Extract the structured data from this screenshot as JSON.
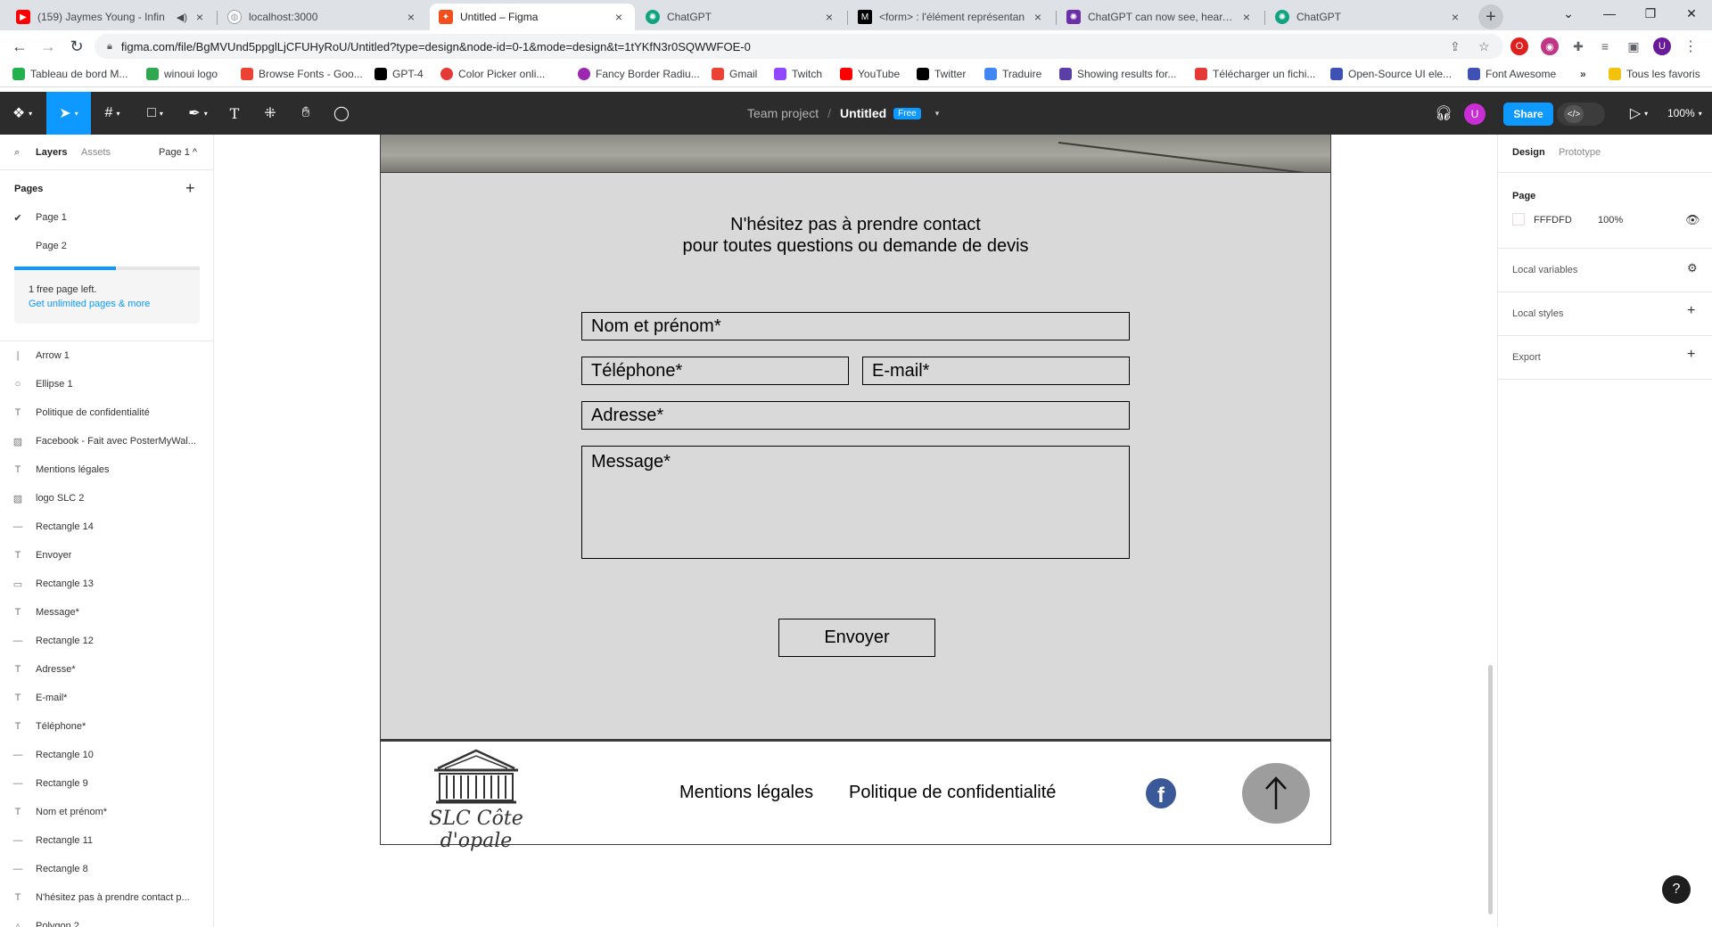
{
  "browser": {
    "tabs": [
      {
        "title": "(159) Jaymes Young - Infin",
        "icon": "youtube-icon",
        "color": "#ff0000"
      },
      {
        "title": "localhost:3000",
        "icon": "globe-icon",
        "color": "#9aa0a6"
      },
      {
        "title": "Untitled – Figma",
        "icon": "figma-icon",
        "color": "#f24e1e",
        "active": true
      },
      {
        "title": "ChatGPT",
        "icon": "chatgpt-icon",
        "color": "#10a37f"
      },
      {
        "title": "<form> : l'élément représentan",
        "icon": "mdn-icon",
        "color": "#000000"
      },
      {
        "title": "ChatGPT can now see, hear, an",
        "icon": "openai-icon",
        "color": "#6b2fa6"
      },
      {
        "title": "ChatGPT",
        "icon": "chatgpt-icon",
        "color": "#10a37f"
      }
    ],
    "url": "figma.com/file/BgMVUnd5ppglLjCFUHyRoU/Untitled?type=design&node-id=0-1&mode=design&t=1tYKfN3r0SQWWFOE-0",
    "bookmarks": [
      {
        "label": "Tableau de bord M...",
        "color": "#22b14c"
      },
      {
        "label": "winoui logo",
        "color": "#2fa84f"
      },
      {
        "label": "Browse Fonts - Goo...",
        "color": "#ea4335"
      },
      {
        "label": "GPT-4",
        "color": "#000000"
      },
      {
        "label": "Color Picker onli...",
        "color": "#e53935"
      },
      {
        "label": "Fancy Border Radiu...",
        "color": "#9c27b0"
      },
      {
        "label": "Gmail",
        "color": "#ea4335"
      },
      {
        "label": "Twitch",
        "color": "#9146ff"
      },
      {
        "label": "YouTube",
        "color": "#ff0000"
      },
      {
        "label": "Twitter",
        "color": "#000000"
      },
      {
        "label": "Traduire",
        "color": "#4285f4"
      },
      {
        "label": "Showing results for...",
        "color": "#5b3fa6"
      },
      {
        "label": "Télécharger un fichi...",
        "color": "#e53935"
      },
      {
        "label": "Open-Source UI ele...",
        "color": "#3f51b5"
      },
      {
        "label": "Font Awesome",
        "color": "#3f51b5"
      }
    ],
    "bookmarks_more": "»",
    "all_bookmarks": "Tous les favoris",
    "profile_initial": "U"
  },
  "figma": {
    "project": "Team project",
    "separator": "/",
    "file_name": "Untitled",
    "plan_badge": "Free",
    "share_label": "Share",
    "zoom": "100%",
    "user_initial": "U"
  },
  "left_panel": {
    "tabs": {
      "layers": "Layers",
      "assets": "Assets",
      "page_selector": "Page 1 ^"
    },
    "pages_header": "Pages",
    "pages": [
      "Page 1",
      "Page 2"
    ],
    "free_progress": 0.55,
    "free_note": "1 free page left.",
    "free_link": "Get unlimited pages & more",
    "layers": [
      {
        "name": "Arrow 1",
        "icon": "arrow-layer-icon",
        "glyph": "|"
      },
      {
        "name": "Ellipse 1",
        "icon": "ellipse-layer-icon",
        "glyph": "○"
      },
      {
        "name": "Politique de confidentialité",
        "icon": "text-layer-icon",
        "glyph": "T"
      },
      {
        "name": "Facebook - Fait avec PosterMyWal...",
        "icon": "image-layer-icon",
        "glyph": "▨"
      },
      {
        "name": "Mentions légales",
        "icon": "text-layer-icon",
        "glyph": "T"
      },
      {
        "name": "logo SLC 2",
        "icon": "image-layer-icon",
        "glyph": "▨"
      },
      {
        "name": "Rectangle 14",
        "icon": "line-layer-icon",
        "glyph": "—"
      },
      {
        "name": "Envoyer",
        "icon": "text-layer-icon",
        "glyph": "T"
      },
      {
        "name": "Rectangle 13",
        "icon": "rectangle-layer-icon",
        "glyph": "▭"
      },
      {
        "name": "Message*",
        "icon": "text-layer-icon",
        "glyph": "T"
      },
      {
        "name": "Rectangle 12",
        "icon": "line-layer-icon",
        "glyph": "—"
      },
      {
        "name": "Adresse*",
        "icon": "text-layer-icon",
        "glyph": "T"
      },
      {
        "name": "E-mail*",
        "icon": "text-layer-icon",
        "glyph": "T"
      },
      {
        "name": "Téléphone*",
        "icon": "text-layer-icon",
        "glyph": "T"
      },
      {
        "name": "Rectangle 10",
        "icon": "line-layer-icon",
        "glyph": "—"
      },
      {
        "name": "Rectangle 9",
        "icon": "line-layer-icon",
        "glyph": "—"
      },
      {
        "name": "Nom et prénom*",
        "icon": "text-layer-icon",
        "glyph": "T"
      },
      {
        "name": "Rectangle 11",
        "icon": "line-layer-icon",
        "glyph": "—"
      },
      {
        "name": "Rectangle 8",
        "icon": "line-layer-icon",
        "glyph": "—"
      },
      {
        "name": "N'hésitez pas à prendre contact p...",
        "icon": "text-layer-icon",
        "glyph": "T"
      },
      {
        "name": "Polygon 2",
        "icon": "polygon-layer-icon",
        "glyph": "△"
      }
    ]
  },
  "canvas": {
    "contact_title_line1": "N'hésitez pas à prendre contact",
    "contact_title_line2": "pour toutes questions ou demande de devis",
    "fields": {
      "name": "Nom et prénom*",
      "phone": "Téléphone*",
      "email": "E-mail*",
      "address": "Adresse*",
      "message": "Message*"
    },
    "send_button": "Envoyer",
    "footer": {
      "logo_text": "SLC Côte d'opale",
      "legal": "Mentions légales",
      "privacy": "Politique de confidentialité",
      "facebook_letter": "f"
    },
    "colors": {
      "contact_bg": "#d9d9d9",
      "to_top_bg": "#9d9d9d",
      "facebook": "#3b5998"
    }
  },
  "right_panel": {
    "tabs": {
      "design": "Design",
      "prototype": "Prototype"
    },
    "page_label": "Page",
    "page_color": "FFFDFD",
    "page_opacity": "100%",
    "local_variables": "Local variables",
    "local_styles": "Local styles",
    "export": "Export"
  },
  "help": "?"
}
